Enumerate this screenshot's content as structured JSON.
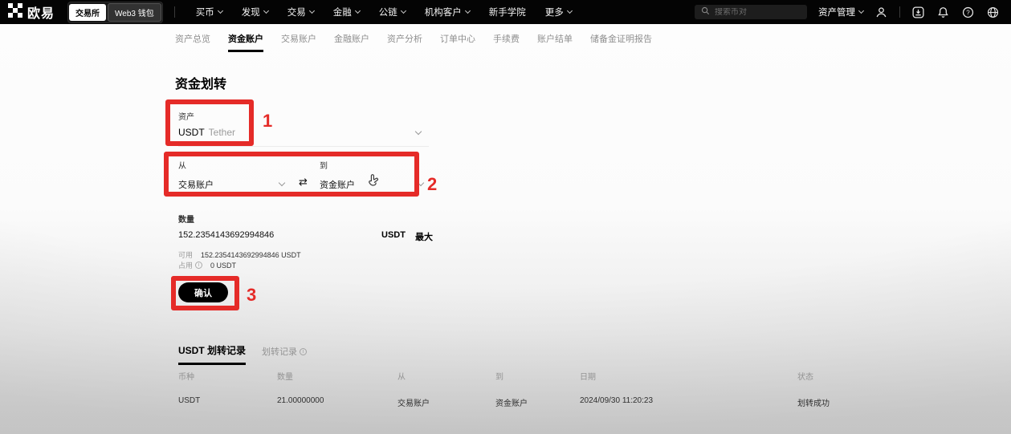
{
  "nav": {
    "brand": "欧易",
    "toggle": {
      "exchange": "交易所",
      "web3": "Web3 钱包"
    },
    "menu": [
      {
        "label": "买币"
      },
      {
        "label": "发现"
      },
      {
        "label": "交易"
      },
      {
        "label": "金融"
      },
      {
        "label": "公链"
      },
      {
        "label": "机构客户"
      },
      {
        "label": "新手学院"
      },
      {
        "label": "更多"
      }
    ],
    "search_placeholder": "搜索币对",
    "asset_manage_label": "资产管理"
  },
  "tabs": {
    "items": [
      "资产总览",
      "资金账户",
      "交易账户",
      "金融账户",
      "资产分析",
      "订单中心",
      "手续费",
      "账户结单",
      "储备金证明报告"
    ],
    "active": "资金账户"
  },
  "transfer": {
    "title": "资金划转",
    "asset_label": "资产",
    "asset_code": "USDT",
    "asset_name": "Tether",
    "from_label": "从",
    "from_value": "交易账户",
    "to_label": "到",
    "to_value": "资金账户",
    "swap_icon": "⇄",
    "amount_label": "数量",
    "amount_value": "152.2354143692994846",
    "amount_currency": "USDT",
    "max_label": "最大",
    "available_label": "可用",
    "available_value": "152.2354143692994846 USDT",
    "inuse_label": "占用",
    "inuse_value": "0 USDT",
    "confirm_label": "确认"
  },
  "annotations": {
    "color": "#e52b28",
    "step1": "1",
    "step2": "2",
    "step3": "3"
  },
  "records": {
    "tab_active": "USDT 划转记录",
    "tab_secondary": "划转记录",
    "headers": [
      "币种",
      "数量",
      "从",
      "到",
      "日期",
      "状态"
    ],
    "rows": [
      {
        "coin": "USDT",
        "amount": "21.00000000",
        "from": "交易账户",
        "to": "资金账户",
        "date": "2024/09/30 11:20:23",
        "status": "划转成功"
      }
    ]
  }
}
